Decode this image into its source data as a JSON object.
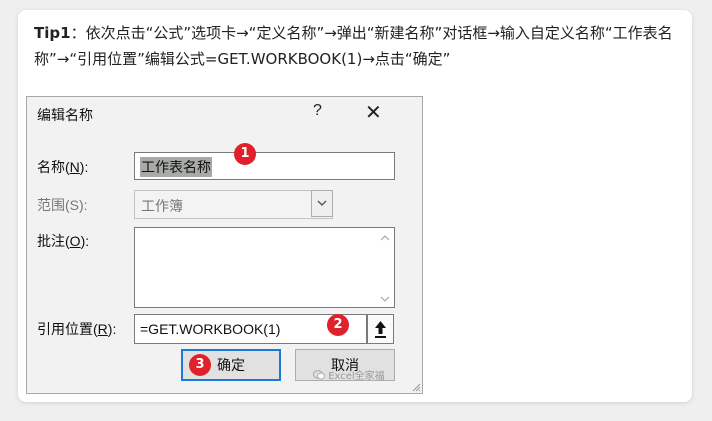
{
  "tip": {
    "lead": "Tip1",
    "text": "：依次点击“公式”选项卡→“定义名称”→弹出“新建名称”对话框→输入自定义名称“工作表名称”→“引用位置”编辑公式=GET.WORKBOOK(1)→点击“确定”"
  },
  "dialog": {
    "title": "编辑名称",
    "help": "?",
    "close": "✕",
    "name_label": {
      "pre": "名称(",
      "key": "N",
      "post": "):"
    },
    "name_value": "工作表名称",
    "scope_label": "范围(S):",
    "scope_value": "工作簿",
    "comment_label": {
      "pre": "批注(",
      "key": "O",
      "post": "):"
    },
    "comment_value": "",
    "ref_label": {
      "pre": "引用位置(",
      "key": "R",
      "post": "):"
    },
    "ref_value": "=GET.WORKBOOK(1)",
    "ok_label": "确定",
    "cancel_label": "取消"
  },
  "badges": [
    "1",
    "2",
    "3"
  ],
  "watermark": "Excel全家福"
}
